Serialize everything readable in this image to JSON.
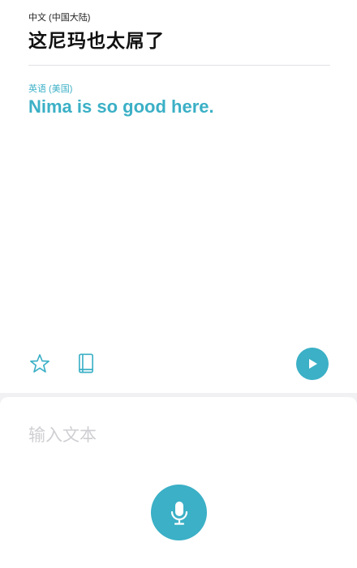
{
  "source": {
    "language": "中文 (中国大陆)",
    "text": "这尼玛也太屌了"
  },
  "translation": {
    "language": "英语 (美国)",
    "text": "Nima is so good here."
  },
  "actions": {
    "favorite_icon": "star-icon",
    "dictionary_icon": "book-icon",
    "play_icon": "play-icon"
  },
  "input": {
    "value": "",
    "placeholder": "输入文本"
  },
  "mic": {
    "icon": "microphone-icon"
  },
  "colors": {
    "accent": "#3bb0c6",
    "background": "#f1f1f3"
  }
}
